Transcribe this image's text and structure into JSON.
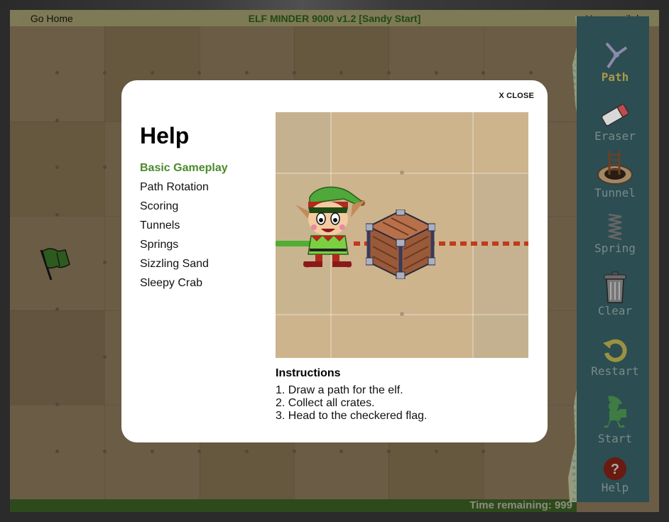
{
  "topbar": {
    "home_icon": "house-icon",
    "home_label": "Go Home",
    "title": "ELF MINDER 9000 v1.2 [Sandy Start]",
    "user_label": "User: maikdev"
  },
  "toolbar": {
    "items": [
      {
        "label": "Path",
        "icon": "path-junction-icon",
        "active": true
      },
      {
        "label": "Eraser",
        "icon": "eraser-icon"
      },
      {
        "label": "Tunnel",
        "icon": "tunnel-ladder-icon"
      },
      {
        "label": "Spring",
        "icon": "spring-icon"
      },
      {
        "label": "Clear",
        "icon": "trash-can-icon"
      },
      {
        "label": "Restart",
        "icon": "restart-icon"
      },
      {
        "label": "Start",
        "icon": "elf-walking-icon"
      },
      {
        "label": "Help",
        "icon": "question-icon"
      }
    ]
  },
  "board": {
    "flag_icon": "green-flag-icon"
  },
  "status": {
    "time_remaining": "Time remaining: 999"
  },
  "help_modal": {
    "close_label": "X CLOSE",
    "title": "Help",
    "topics": [
      {
        "label": "Basic Gameplay",
        "active": true
      },
      {
        "label": "Path Rotation"
      },
      {
        "label": "Scoring"
      },
      {
        "label": "Tunnels"
      },
      {
        "label": "Springs"
      },
      {
        "label": "Sizzling Sand"
      },
      {
        "label": "Sleepy Crab"
      }
    ],
    "preview": {
      "elf_icon": "elf-icon",
      "crate_icon": "crate-icon"
    },
    "instructions_title": "Instructions",
    "instructions": [
      "1. Draw a path for the elf.",
      "2. Collect all crates.",
      "3. Head to the checkered flag."
    ]
  },
  "colors": {
    "topbar_bg": "#7e7a55",
    "title_text": "#1f4a14",
    "active_topic": "#4b8a2c",
    "active_tool": "#a89a4a",
    "sea": "#2c4d52",
    "timebar": "#2d4a1c"
  }
}
